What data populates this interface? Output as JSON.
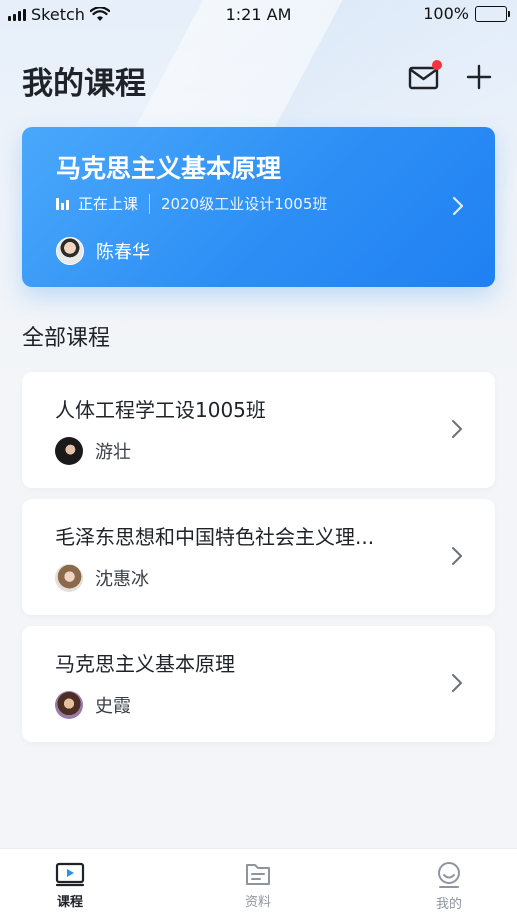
{
  "status_bar": {
    "carrier": "Sketch",
    "time": "1:21 AM",
    "battery": "100%"
  },
  "header": {
    "title": "我的课程",
    "mail_icon": "mail-icon",
    "add_icon": "plus-icon",
    "has_unread": true
  },
  "featured_course": {
    "title": "马克思主义基本原理",
    "status": "正在上课",
    "class_name": "2020级工业设计1005班",
    "teacher": "陈春华"
  },
  "all_courses": {
    "section_title": "全部课程",
    "items": [
      {
        "name": "人体工程学工设1005班",
        "teacher": "游壮"
      },
      {
        "name": "毛泽东思想和中国特色社会主义理...",
        "teacher": "沈惠冰"
      },
      {
        "name": "马克思主义基本原理",
        "teacher": "史霞"
      }
    ]
  },
  "tab_bar": {
    "tabs": [
      {
        "label": "课程",
        "icon": "video-icon",
        "active": true
      },
      {
        "label": "资料",
        "icon": "folder-icon",
        "active": false
      },
      {
        "label": "我的",
        "icon": "smiley-icon",
        "active": false
      }
    ]
  },
  "colors": {
    "accent": "#2d8ff5",
    "badge": "#f5333f",
    "background": "#f3f5f8"
  }
}
